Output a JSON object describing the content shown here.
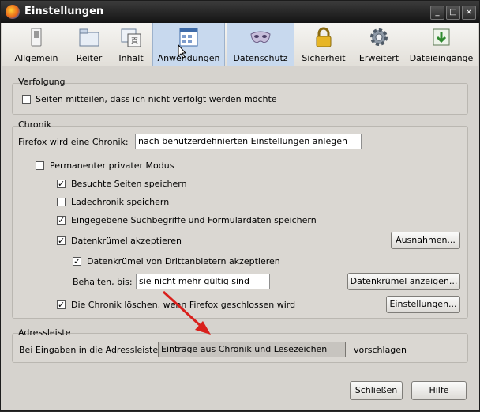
{
  "window": {
    "title": "Einstellungen",
    "minimize": "_",
    "maximize": "□",
    "close": "×"
  },
  "tabs": [
    {
      "label": "Allgemein",
      "icon": "switch-icon"
    },
    {
      "label": "Reiter",
      "icon": "folder-tabs-icon"
    },
    {
      "label": "Inhalt",
      "icon": "content-icon"
    },
    {
      "label": "Anwendungen",
      "icon": "applications-icon"
    },
    {
      "label": "Datenschutz",
      "icon": "mask-icon"
    },
    {
      "label": "Sicherheit",
      "icon": "padlock-icon"
    },
    {
      "label": "Erweitert",
      "icon": "gear-icon"
    },
    {
      "label": "Dateieingänge",
      "icon": "download-icon"
    }
  ],
  "tracking": {
    "title": "Verfolgung",
    "do_not_track_label": "Seiten mitteilen, dass ich nicht verfolgt werden möchte",
    "do_not_track_checked": false
  },
  "history": {
    "title": "Chronik",
    "mode_label": "Firefox wird eine Chronik:",
    "mode_value": "nach benutzerdefinierten Einstellungen anlegen",
    "private_mode_label": "Permanenter privater Modus",
    "remember_visited_label": "Besuchte Seiten speichern",
    "remember_downloads_label": "Ladechronik speichern",
    "remember_forms_label": "Eingegebene Suchbegriffe und Formulardaten speichern",
    "accept_cookies_label": "Datenkrümel akzeptieren",
    "exceptions_button": "Ausnahmen...",
    "third_party_label": "Datenkrümel von Drittanbietern akzeptieren",
    "keep_until_label": "Behalten, bis:",
    "keep_until_value": "sie nicht mehr gültig sind",
    "show_cookies_button": "Datenkrümel anzeigen...",
    "clear_on_close_label": "Die Chronik löschen, wenn Firefox geschlossen wird",
    "settings_button": "Einstellungen..."
  },
  "urlbar": {
    "title": "Adressleiste",
    "suggest_label": "Bei Eingaben in die Adressleiste",
    "suggest_value": "Einträge aus Chronik und Lesezeichen",
    "suggest_suffix": "vorschlagen"
  },
  "footer": {
    "close_button": "Schließen",
    "help_button": "Hilfe"
  },
  "colors": {
    "annotation_arrow": "#d9201c"
  }
}
